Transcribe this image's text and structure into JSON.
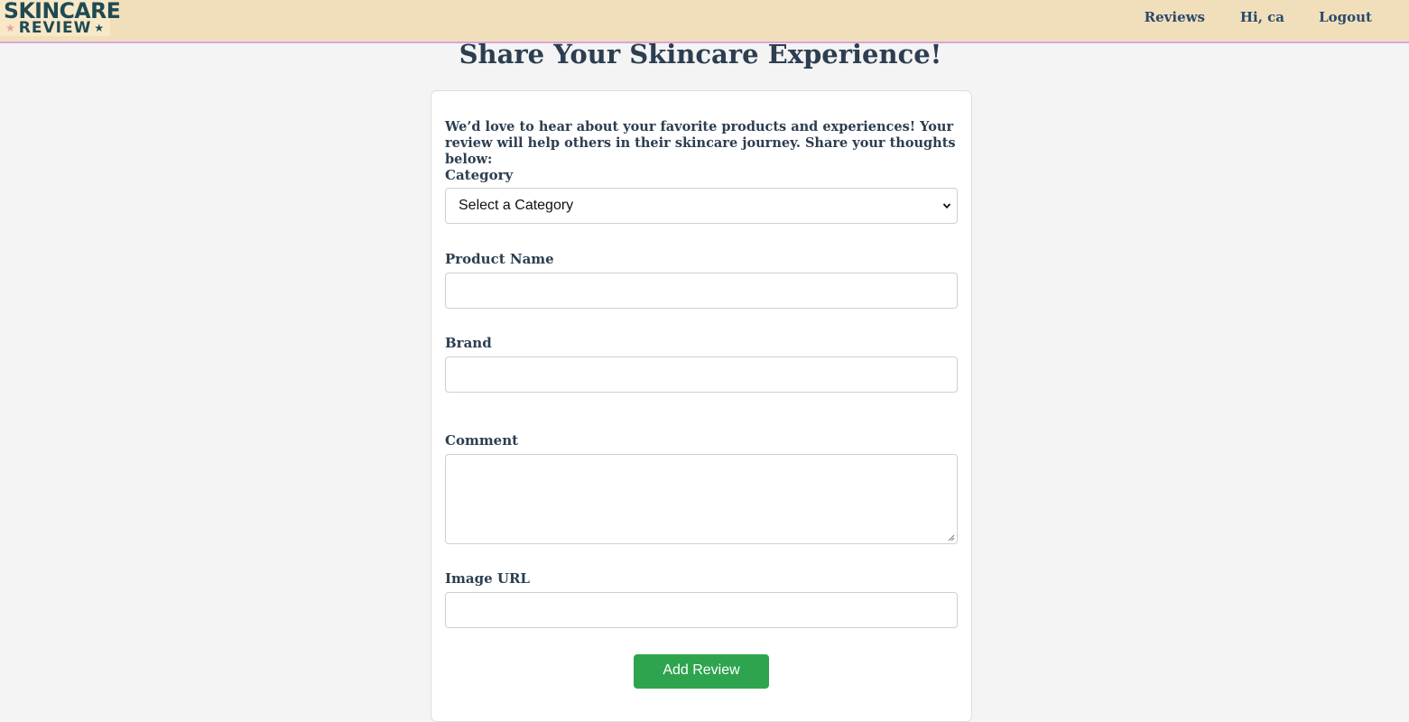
{
  "logo": {
    "line1": "SKINCARE",
    "line2": "REVIEW"
  },
  "nav": {
    "reviews": "Reviews",
    "greeting": "Hi, ca",
    "logout": "Logout"
  },
  "page": {
    "title": "Share Your Skincare Experience!"
  },
  "form": {
    "intro": "We’d love to hear about your favorite products and experiences! Your review will help others in their skincare journey. Share your thoughts below:",
    "category_label": "Category",
    "category_selected": "Select a Category",
    "product_name_label": "Product Name",
    "product_name_value": "",
    "brand_label": "Brand",
    "brand_value": "",
    "comment_label": "Comment",
    "comment_value": "",
    "image_url_label": "Image URL",
    "image_url_value": "",
    "submit_label": "Add Review"
  },
  "colors": {
    "navbar_bg": "#f1dfbc",
    "navbar_border": "#d8a6e0",
    "page_bg": "#f4f4f4",
    "text": "#2c3e50",
    "button": "#2ea44f",
    "logo_text": "#1f4a52",
    "logo_star_pink": "#e8a2a2"
  },
  "icons": {
    "select": "chevron-down-icon",
    "textarea": "resize-grip-icon",
    "logo_stars": "star-icon"
  }
}
